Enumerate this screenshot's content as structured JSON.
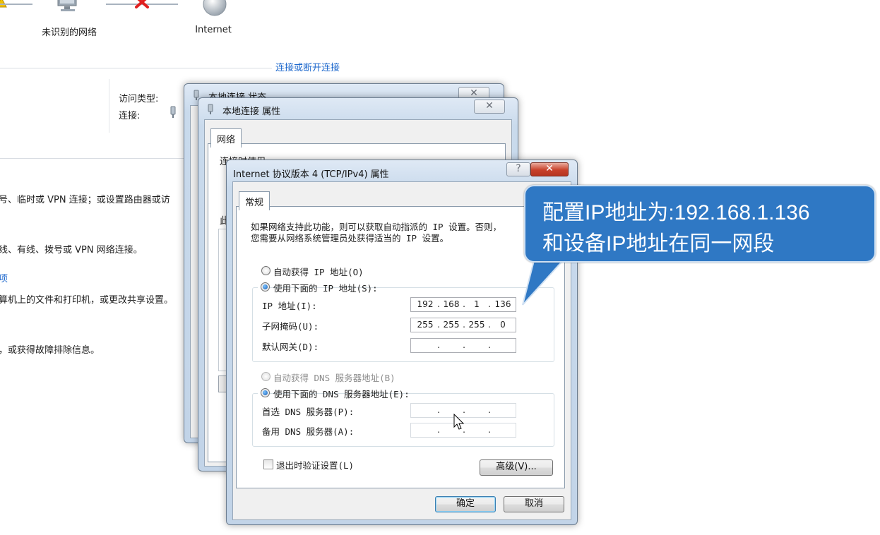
{
  "network_map": {
    "unidentified_label": "未识别的网络",
    "internet_label": "Internet",
    "connect_link": "连接或断开连接"
  },
  "active_network": {
    "access_type_label": "访问类型:",
    "connection_label": "连接:"
  },
  "bg_tasks": {
    "line1": "号、临时或 VPN 连接；或设置路由器或访",
    "line2": "线、有线、拨号或 VPN 网络连接。",
    "link3": "项",
    "line3": "算机上的文件和打印机，或更改共享设置。",
    "line4": "，或获得故障排除信息。"
  },
  "status_window": {
    "title": "本地连接 状态"
  },
  "props_window": {
    "title": "本地连接 属性",
    "tab": "网络",
    "connect_using": "连接时使用:",
    "partial_label": "此"
  },
  "ipv4_dialog": {
    "title": "Internet 协议版本 4 (TCP/IPv4) 属性",
    "help_glyph": "?",
    "tab": "常规",
    "desc_line1": "如果网络支持此功能，则可以获取自动指派的 IP 设置。否则，",
    "desc_line2": "您需要从网络系统管理员处获得适当的 IP 设置。",
    "auto_ip": "自动获得 IP 地址(O)",
    "manual_ip": "使用下面的 IP 地址(S):",
    "ip_label": "IP 地址(I):",
    "subnet_label": "子网掩码(U):",
    "gateway_label": "默认网关(D):",
    "ip_octets": [
      "192",
      "168",
      "1",
      "136"
    ],
    "subnet_octets": [
      "255",
      "255",
      "255",
      "0"
    ],
    "auto_dns": "自动获得 DNS 服务器地址(B)",
    "manual_dns": "使用下面的 DNS 服务器地址(E):",
    "preferred_dns_label": "首选 DNS 服务器(P):",
    "alternate_dns_label": "备用 DNS 服务器(A):",
    "validate_label": "退出时验证设置(L)",
    "advanced_button": "高级(V)...",
    "ok_button": "确定",
    "cancel_button": "取消"
  },
  "callout": {
    "line1": "配置IP地址为:192.168.1.136",
    "line2": "和设备IP地址在同一网段"
  },
  "colors": {
    "callout_bg": "#2f78c4",
    "link": "#1a66cc",
    "error_red": "#e02020"
  }
}
